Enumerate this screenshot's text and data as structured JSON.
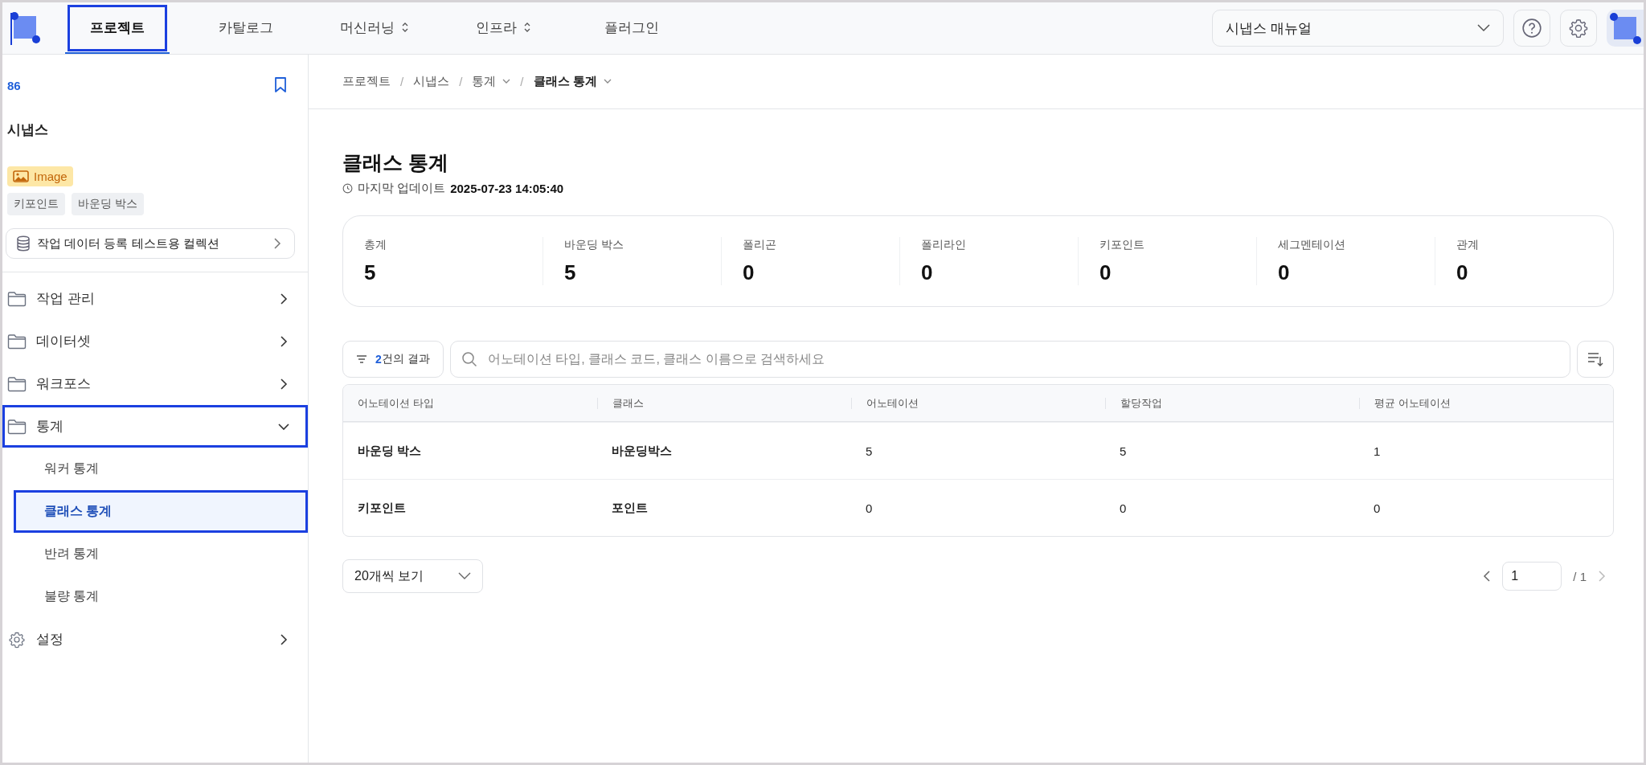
{
  "nav": {
    "tabs": [
      {
        "label": "프로젝트",
        "selected": true,
        "highlighted": true,
        "dropdown": false
      },
      {
        "label": "카탈로그",
        "selected": false,
        "highlighted": false,
        "dropdown": false
      },
      {
        "label": "머신러닝",
        "selected": false,
        "highlighted": false,
        "dropdown": true
      },
      {
        "label": "인프라",
        "selected": false,
        "highlighted": false,
        "dropdown": true
      },
      {
        "label": "플러그인",
        "selected": false,
        "highlighted": false,
        "dropdown": false
      }
    ],
    "project_select": {
      "value": "시냅스 매뉴얼"
    }
  },
  "sidebar": {
    "project_id": "86",
    "project_name": "시냅스",
    "data_type": "Image",
    "annotation_tags": [
      "키포인트",
      "바운딩 박스"
    ],
    "collection": "작업 데이터 등록 테스트용 컬렉션",
    "items": [
      {
        "label": "작업 관리",
        "kind": "folder",
        "expanded": false,
        "highlighted": false
      },
      {
        "label": "데이터셋",
        "kind": "folder",
        "expanded": false,
        "highlighted": false
      },
      {
        "label": "워크포스",
        "kind": "folder",
        "expanded": false,
        "highlighted": false
      },
      {
        "label": "통계",
        "kind": "folder",
        "expanded": true,
        "highlighted": true,
        "children": [
          {
            "label": "워커 통계",
            "selected": false,
            "highlighted": false
          },
          {
            "label": "클래스 통계",
            "selected": true,
            "highlighted": true
          },
          {
            "label": "반려 통계",
            "selected": false,
            "highlighted": false
          },
          {
            "label": "불량 통계",
            "selected": false,
            "highlighted": false
          }
        ]
      },
      {
        "label": "설정",
        "kind": "settings",
        "expanded": false,
        "highlighted": false
      }
    ]
  },
  "breadcrumb": [
    {
      "label": "프로젝트",
      "dropdown": false
    },
    {
      "separator": "/",
      "label": "시냅스",
      "dropdown": false
    },
    {
      "separator": "/",
      "label": "통계",
      "dropdown": true
    },
    {
      "separator": "/",
      "label": "클래스 통계",
      "dropdown": true
    }
  ],
  "page": {
    "title": "클래스 통계",
    "updated_label": "마지막 업데이트",
    "updated_value": "2025-07-23 14:05:40"
  },
  "stats": [
    {
      "label": "총계",
      "value": "5"
    },
    {
      "label": "바운딩 박스",
      "value": "5"
    },
    {
      "label": "폴리곤",
      "value": "0"
    },
    {
      "label": "폴리라인",
      "value": "0"
    },
    {
      "label": "키포인트",
      "value": "0"
    },
    {
      "label": "세그멘테이션",
      "value": "0"
    },
    {
      "label": "관계",
      "value": "0"
    }
  ],
  "toolbar": {
    "result_count": "2",
    "result_suffix": "건의 결과",
    "search_placeholder": "어노테이션 타입, 클래스 코드, 클래스 이름으로 검색하세요"
  },
  "table": {
    "columns": [
      "어노테이션 타입",
      "클래스",
      "어노테이션",
      "할당작업",
      "평균 어노테이션"
    ],
    "rows": [
      [
        "바운딩 박스",
        "바운딩박스",
        "5",
        "5",
        "1"
      ],
      [
        "키포인트",
        "포인트",
        "0",
        "0",
        "0"
      ]
    ]
  },
  "pagination": {
    "page_size": "20개씩 보기",
    "current_page": "1",
    "total_pages": "/ 1"
  }
}
